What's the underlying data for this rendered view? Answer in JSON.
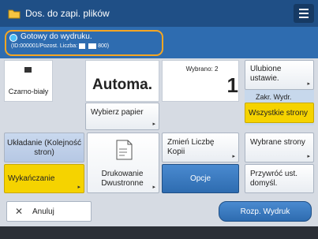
{
  "title": {
    "text": "Dos. do zapi. plików",
    "icon": "folder-icon"
  },
  "status": {
    "main": "Gotowy do wydruku.",
    "sub": "(ID:000001/Pozost. Liczba:",
    "sub_count": "800)"
  },
  "color_mode": {
    "icon": "color-mode-icon",
    "label": "Czarno-biały"
  },
  "paper": {
    "value": "Automa.",
    "select_label": "Wybierz papier"
  },
  "copies": {
    "label": "Wybrano: 2",
    "value": "1",
    "change_label": "Zmień Liczbę Kopii"
  },
  "finishing": {
    "layout_label": "Układanie (Kolejność stron)",
    "finishing_label": "Wykańczanie"
  },
  "duplex": {
    "icon": "page-icon",
    "label": "Drukowanie Dwustronne"
  },
  "options_label": "Opcje",
  "sidebar": {
    "favorites_label": "Ulubione ustawie.",
    "range_label": "Zakr. Wydr.",
    "all_pages_label": "Wszystkie strony",
    "selected_pages_label": "Wybrane strony",
    "restore_label": "Przywróć ust. domyśl."
  },
  "bottom": {
    "cancel_icon": "close-icon",
    "cancel_label": "Anuluj",
    "start_label": "Rozp. Wydruk"
  },
  "colors": {
    "accent": "#f5d300",
    "blue": "#2e6cb0",
    "status_border": "#f5a623"
  }
}
